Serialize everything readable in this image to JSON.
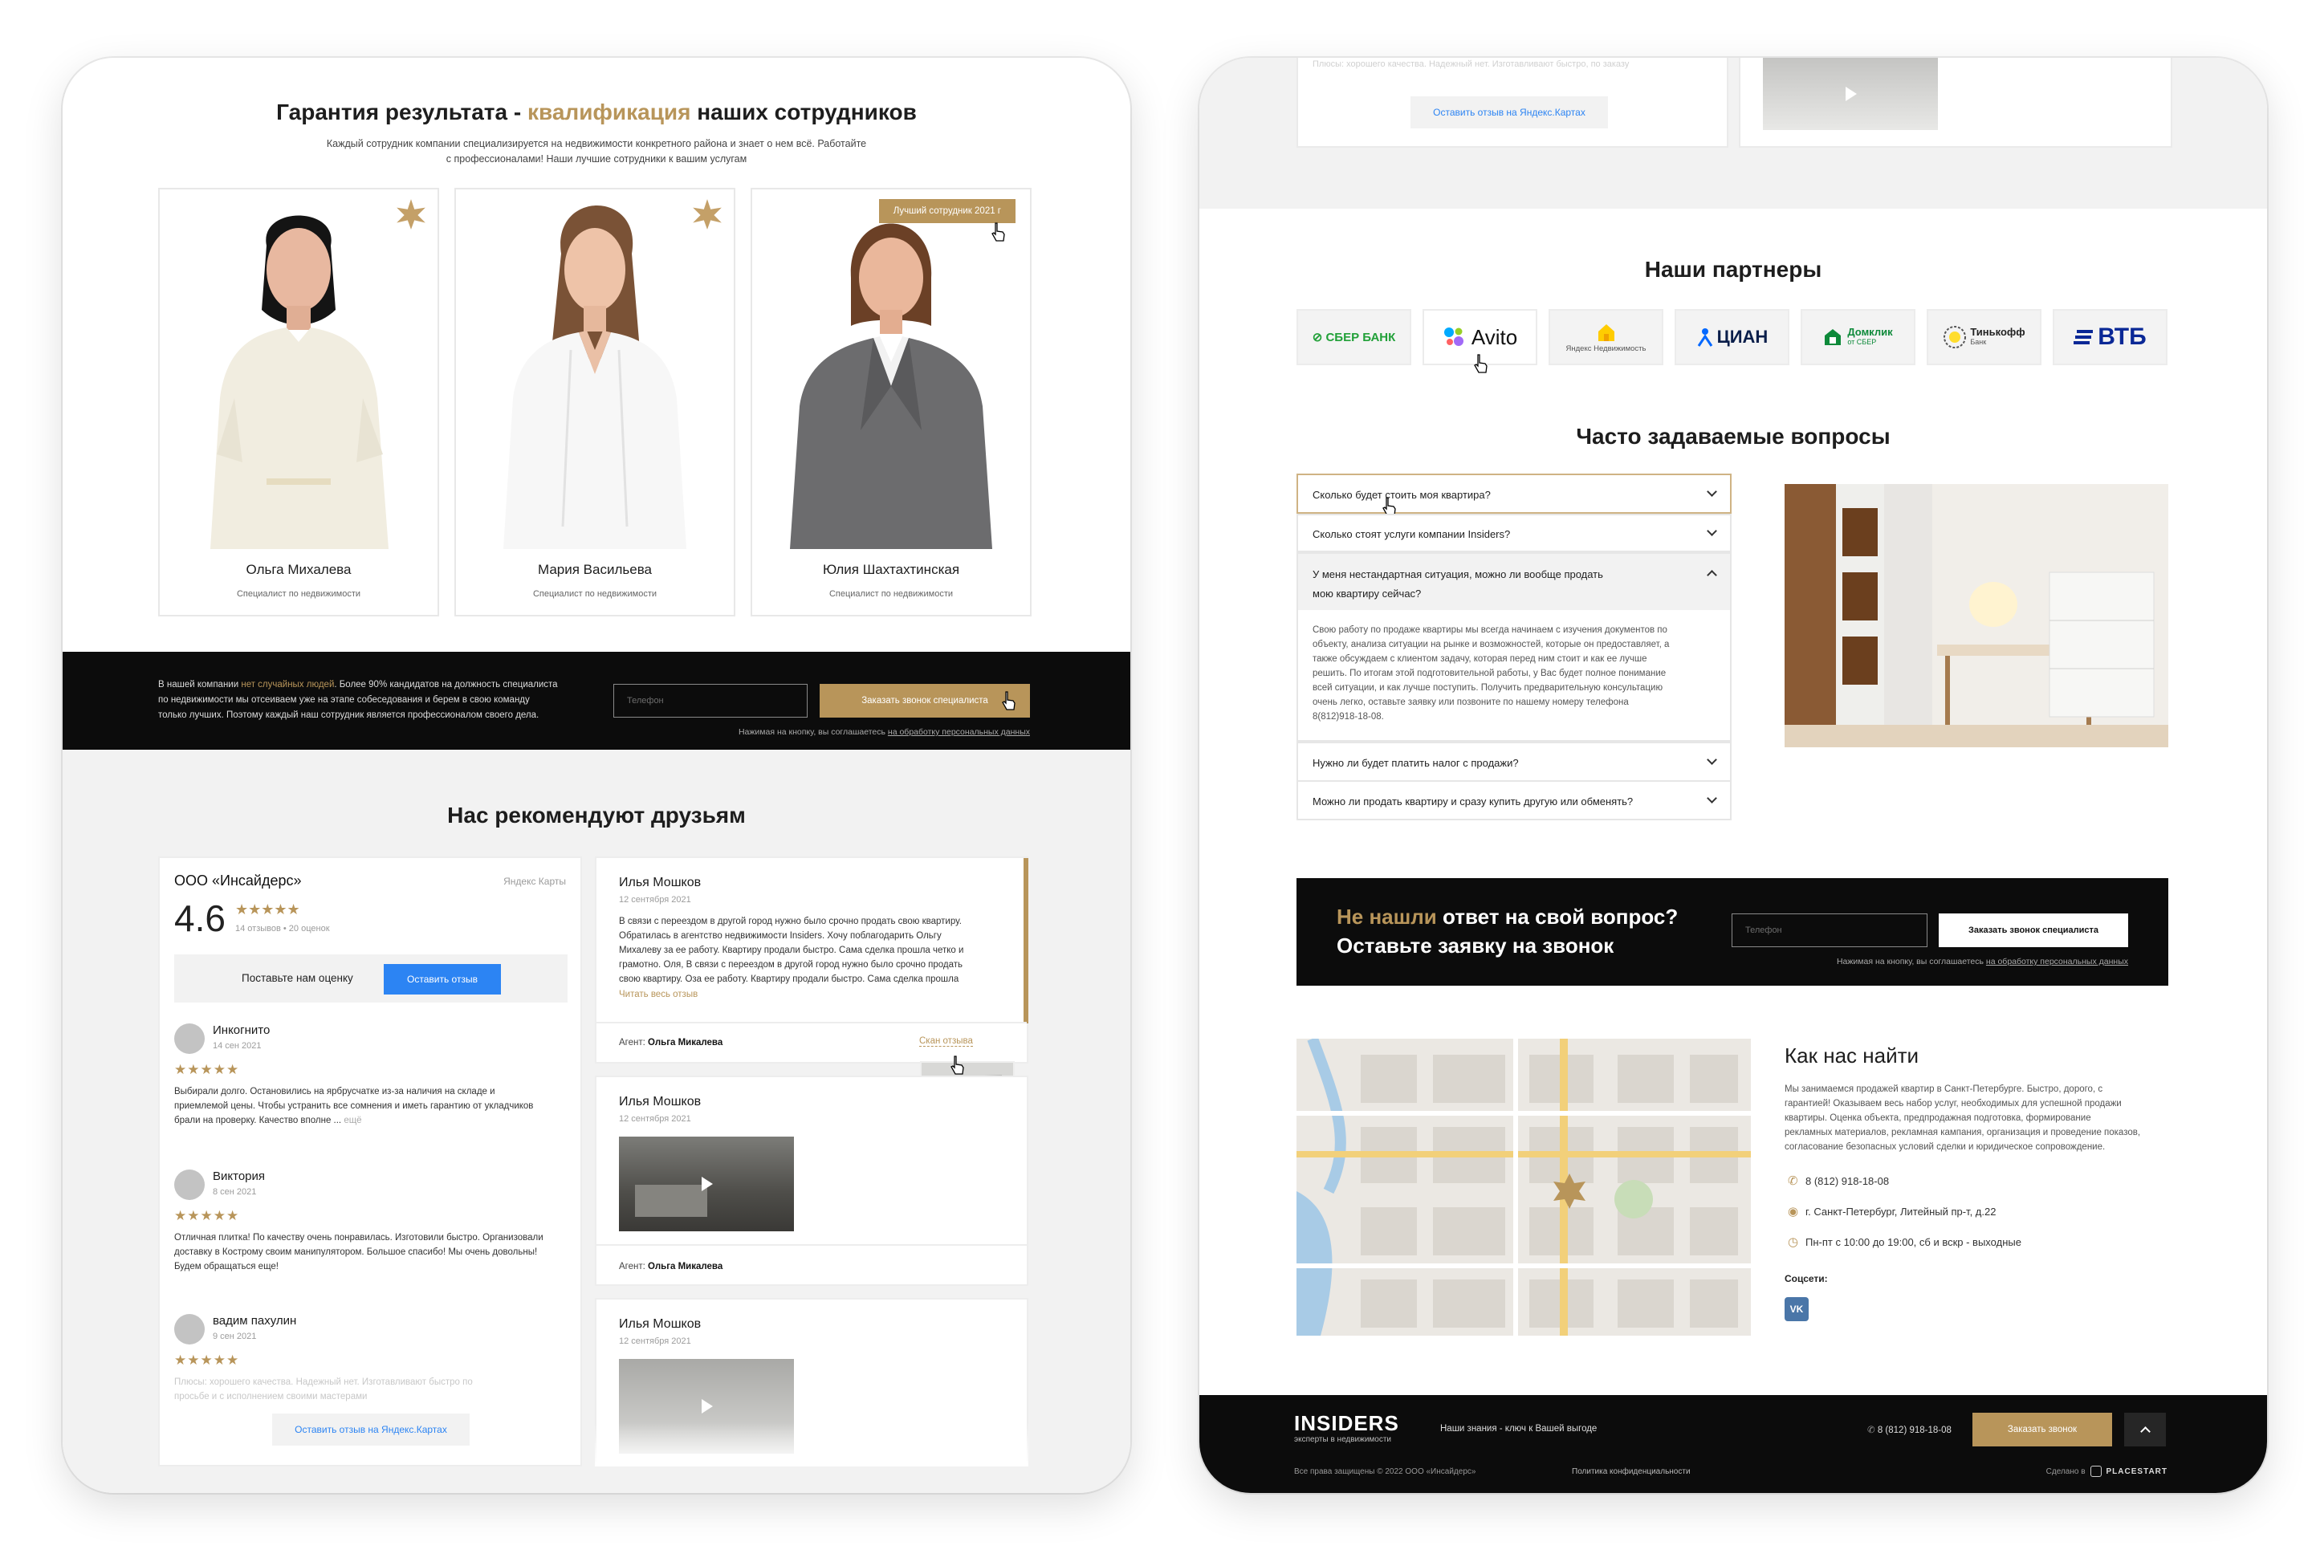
{
  "left": {
    "team": {
      "title_pre": "Гарантия результата - ",
      "title_accent": "квалификация",
      "title_post": " наших сотрудников",
      "subtitle_l1": "Каждый сотрудник компании специализируется на недвижимости конкретного района и знает о нем всё. Работайте",
      "subtitle_l2": "с профессионалами! Наши лучшие сотрудники к вашим услугам",
      "members": [
        {
          "name": "Ольга Михалева",
          "role": "Специалист по недвижимости"
        },
        {
          "name": "Мария Васильева",
          "role": "Специалист по недвижимости"
        },
        {
          "name": "Юлия Шахтахтинская",
          "role": "Специалист по недвижимости",
          "badge": "Лучший сотрудник 2021 г"
        }
      ]
    },
    "cta": {
      "text_pre": "В нашей компании ",
      "text_accent": "нет случайных людей",
      "text_l1_post": ". Более 90% кандидатов на должность специалиста",
      "text_l2": "по недвижимости мы отсеиваем уже на этапе собеседования и берем в свою команду",
      "text_l3": "только лучших. Поэтому каждый наш сотрудник является  профессионалом своего дела.",
      "phone_placeholder": "Телефон",
      "button": "Заказать звонок специалиста",
      "consent_pre": "Нажимая на кнопку, вы соглашаетесь ",
      "consent_link": "на обработку персональных данных"
    },
    "reviews": {
      "title": "Нас рекомендуют друзьям",
      "yandex": {
        "company": "ООО «Инсайдерс»",
        "source": "Яндекс Карты",
        "rating": "4.6",
        "rating_stars": "★★★★★",
        "meta": "14 отзывов • 20 оценок",
        "rate_label": "Поставьте нам оценку",
        "leave_label": "Оставить отзыв",
        "items": [
          {
            "name": "Инкогнито",
            "date": "14 сен 2021",
            "stars": "★★★★★",
            "l1": "Выбирали долго. Остановились на ярбрусчатке из-за наличия на складе и",
            "l2": "приемлемой цены. Чтобы устранить все сомнения и иметь гарантию от укладчиков",
            "l3": "брали на проверку. Качество вполне ...",
            "more": " ещё"
          },
          {
            "name": "Виктория",
            "date": "8 сен 2021",
            "stars": "★★★★★",
            "l1": "Отличная плитка! По качеству очень понравилась. Изготовили быстро. Организовали",
            "l2": "доставку в Кострому своим манипулятором. Большое спасибо! Мы очень довольны!",
            "l3": "Будем обращаться еще!",
            "more": ""
          },
          {
            "name": "вадим пахулин",
            "date": "9 сен 2021",
            "stars": "★★★★★",
            "l1": "Плюсы: хорошего качества. Надежный нет. Изготавливают быстро по",
            "l2": "просьбе и с исполнением своими мастерами",
            "l3": "",
            "more": ""
          }
        ],
        "bottom_link": "Оставить отзыв на Яндекс.Картах"
      },
      "cards": [
        {
          "name": "Илья Мошков",
          "date": "12 сентября 2021",
          "l1": "В связи с переездом в другой город нужно было срочно продать свою квартиру.",
          "l2": "Обратилась в агентство недвижимости Insiders. Хочу поблагодарить Ольгу",
          "l3": "Михалеву за ее работу. Квартиру продали быстро. Сама сделка прошла четко и",
          "l4": "грамотно. Оля, В связи с переездом в другой город нужно было срочно продать",
          "l5": "свою квартиру. Оза ее работу. Квартиру продали быстро. Сама сделка прошла",
          "read_more": "Читать весь отзыв",
          "agent_label": "Агент: ",
          "agent": "Ольга Микалева",
          "scan": "Скан отзыва"
        },
        {
          "name": "Илья Мошков",
          "date": "12 сентября 2021",
          "agent_label": "Агент: ",
          "agent": "Ольга Микалева"
        },
        {
          "name": "Илья Мошков",
          "date": "12 сентября 2021"
        }
      ]
    }
  },
  "right": {
    "top_snippet": {
      "text": "Плюсы: хорошего качества. Надежный нет. Изготавливают быстро, по заказу",
      "link": "Оставить отзыв на Яндекс.Картах"
    },
    "partners": {
      "title": "Наши партнеры",
      "items": [
        {
          "name": "СБЕР БАНК",
          "color": "#21a038"
        },
        {
          "name": "Avito",
          "color": "#111111"
        },
        {
          "name": "Яндекс Недвижимость",
          "color": "#555555"
        },
        {
          "name": "ЦИАН",
          "color": "#0468ff"
        },
        {
          "name": "Домклик",
          "sub": "от СБЕР",
          "color": "#0e8a3a"
        },
        {
          "name": "Тинькофф",
          "sub": "Банк",
          "color": "#222222"
        },
        {
          "name": "ВТБ",
          "color": "#0a2896"
        }
      ]
    },
    "faq": {
      "title": "Часто задаваемые вопросы",
      "q1": "Сколько будет стоить моя квартира?",
      "q2": "Сколько стоят услуги компании Insiders?",
      "q3_l1": "У меня нестандартная ситуация, можно ли вообще продать",
      "q3_l2": "мою квартиру сейчас?",
      "a3": [
        "Свою работу по продаже квартиры мы всегда начинаем с изучения документов по",
        "объекту, анализа ситуации на рынке и возможностей, которые он предоставляет, а",
        "также обсуждаем с клиентом задачу, которая перед ним стоит и как ее лучше",
        "решить. По итогам этой подготовительной работы, у Вас будет полное понимание",
        "всей ситуации, и как лучше поступить. Получить предварительную консультацию",
        "очень легко, оставьте заявку или позвоните по нашему номеру телефона",
        "8(812)918-18-08."
      ],
      "q4": "Нужно ли будет платить налог с продажи?",
      "q5": "Можно ли продать квартиру и сразу купить другую или обменять?"
    },
    "cta": {
      "title_accent": "Не нашли",
      "title_l1_post": " ответ на свой вопрос?",
      "title_l2": "Оставьте заявку на звонок",
      "phone_placeholder": "Телефон",
      "button": "Заказать звонок специалиста",
      "consent_pre": "Нажимая на кнопку, вы соглашаетесь ",
      "consent_link": "на обработку персональных данных"
    },
    "contacts": {
      "title": "Как нас найти",
      "desc": [
        "Мы занимаемся продажей квартир в Санкт-Петербурге. Быстро, дорого, с",
        "гарантией! Оказываем весь набор услуг, необходимых для успешной продажи",
        "квартиры. Оценка объекта, предпродажная подготовка, формирование",
        "рекламных материалов, рекламная кампания, организация и проведение показов,",
        "согласование безопасных условий сделки и юридическое сопровождение."
      ],
      "phone": "8 (812) 918-18-08",
      "address": "г. Санкт-Петербург, Литейный пр-т, д.22",
      "hours": "Пн-пт с 10:00 до 19:00, сб и вскр - выходные",
      "social_label": "Соцсети:",
      "vk": "VK"
    },
    "footer": {
      "logo": "INSIDERS",
      "logo_sub": "эксперты в недвижимости",
      "slogan": "Наши знания - ключ к Вашей выгоде",
      "phone": "8 (812) 918-18-08",
      "button": "Заказать звонок",
      "copyright": "Все права защищены © 2022 ООО «Инсайдерс»",
      "privacy": "Политика конфиденциальности",
      "made_by": "Сделано в",
      "studio": "PLACESTART"
    }
  }
}
